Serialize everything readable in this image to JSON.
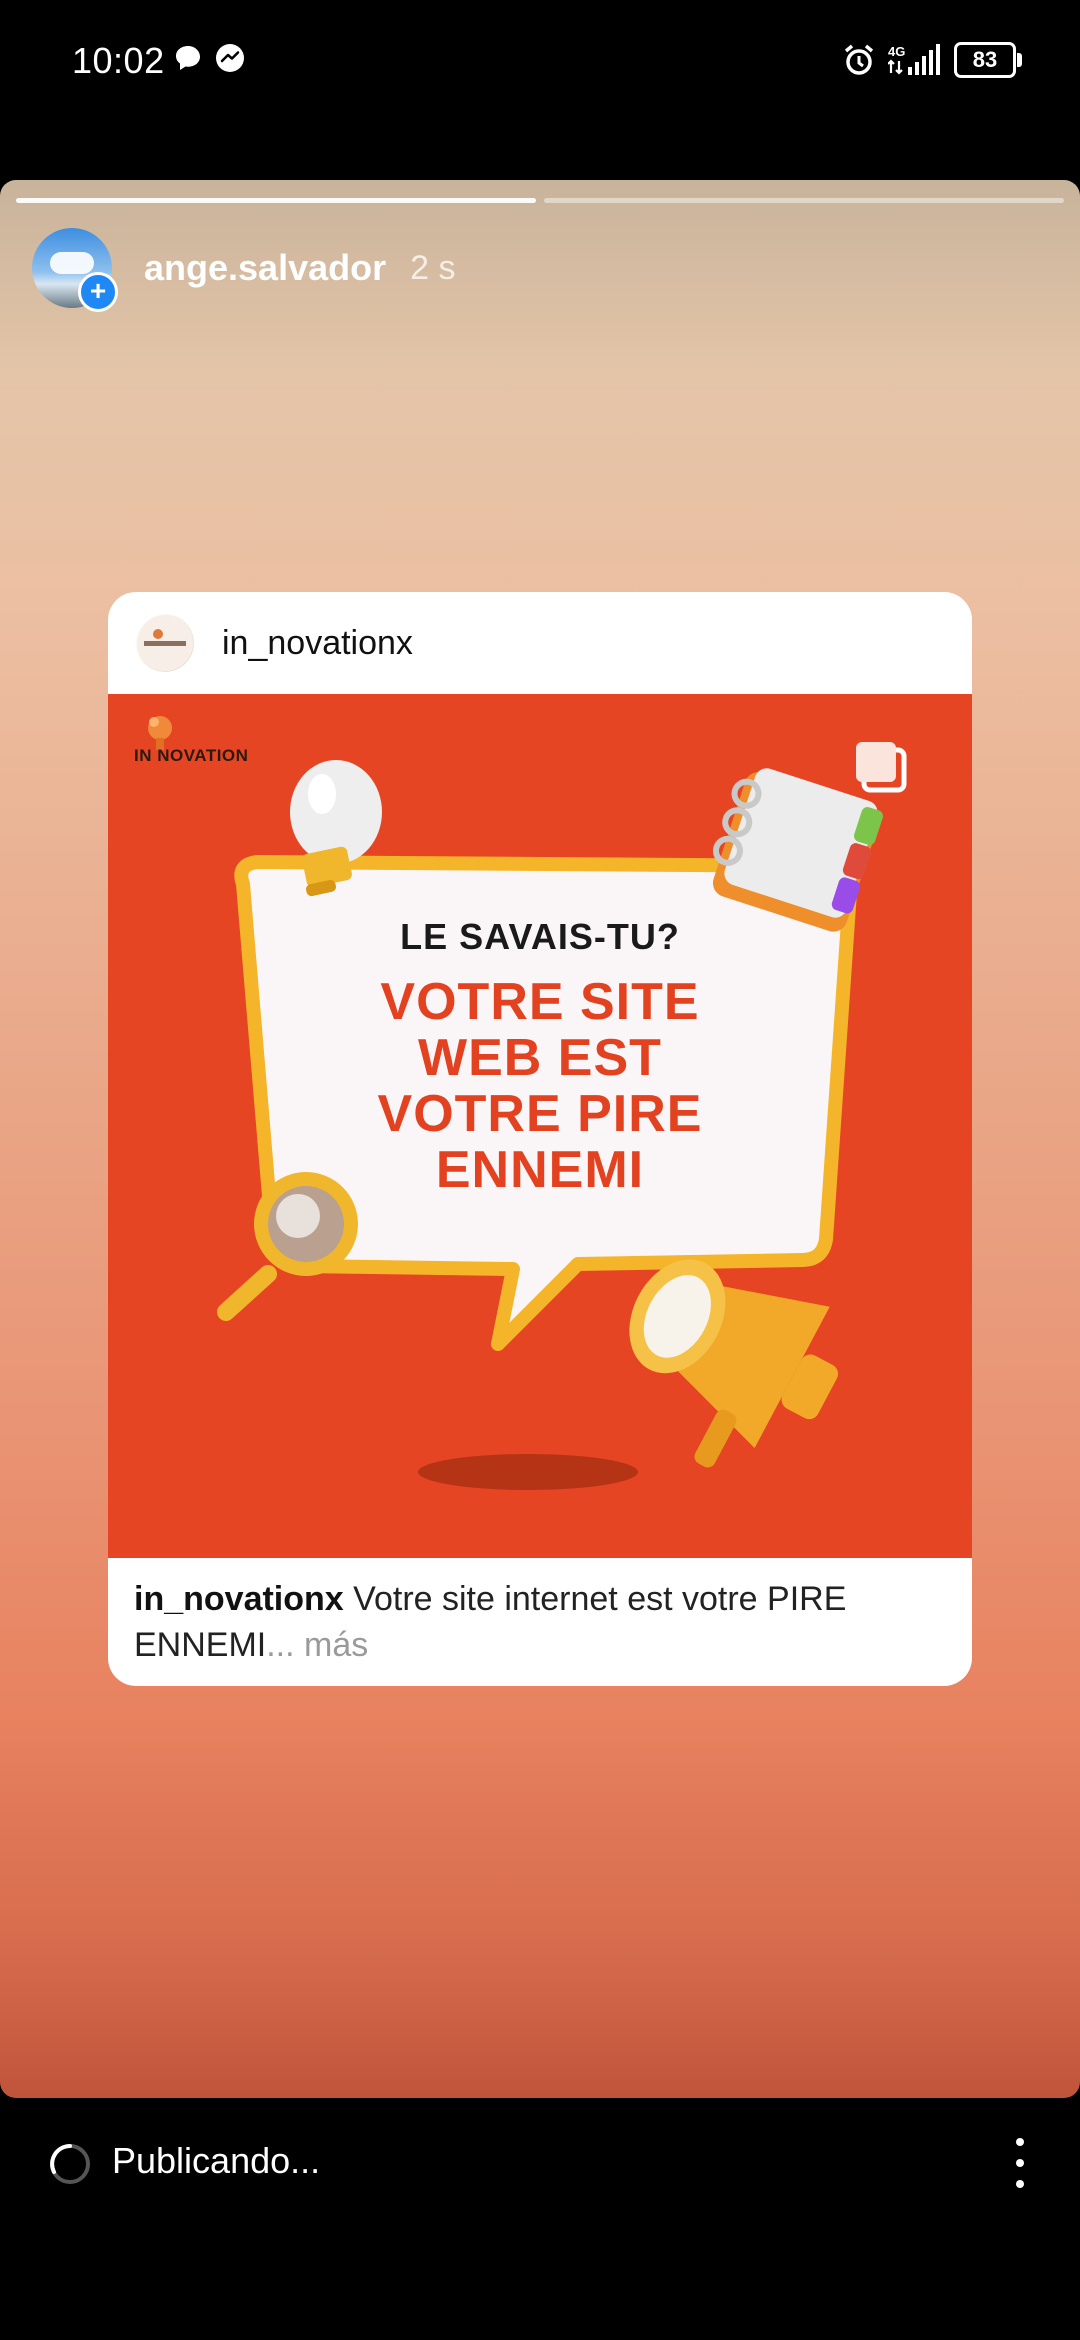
{
  "status_bar": {
    "time": "10:02",
    "notification_icons": [
      "chat-bubble-icon",
      "messenger-icon"
    ],
    "right_icons": [
      "alarm-icon",
      "4g-network-icon",
      "signal-bars-icon",
      "battery-icon"
    ],
    "network_label": "4G",
    "battery": "83"
  },
  "story": {
    "progress_segments": 2,
    "active_segment": 1,
    "username": "ange.salvador",
    "time_ago": "2 s",
    "colors": {
      "top": "#c8b39b",
      "middle": "#e9a98a",
      "bottom": "#c0543b"
    }
  },
  "shared_post": {
    "username": "in_novationx",
    "image": {
      "brand": "IN NOVATION",
      "line1": "LE SAVAIS-TU?",
      "headline": [
        "VOTRE SITE",
        "WEB EST",
        "VOTRE PIRE",
        "ENNEMI"
      ],
      "background_color": "#e54522",
      "headline_color": "#e2421f"
    },
    "caption_username": "in_novationx",
    "caption_text": "Votre site internet est votre PIRE ENNEMI",
    "caption_more": "... más"
  },
  "bottom_bar": {
    "status_text": "Publicando...",
    "menu_icon": "more-vertical-icon"
  }
}
